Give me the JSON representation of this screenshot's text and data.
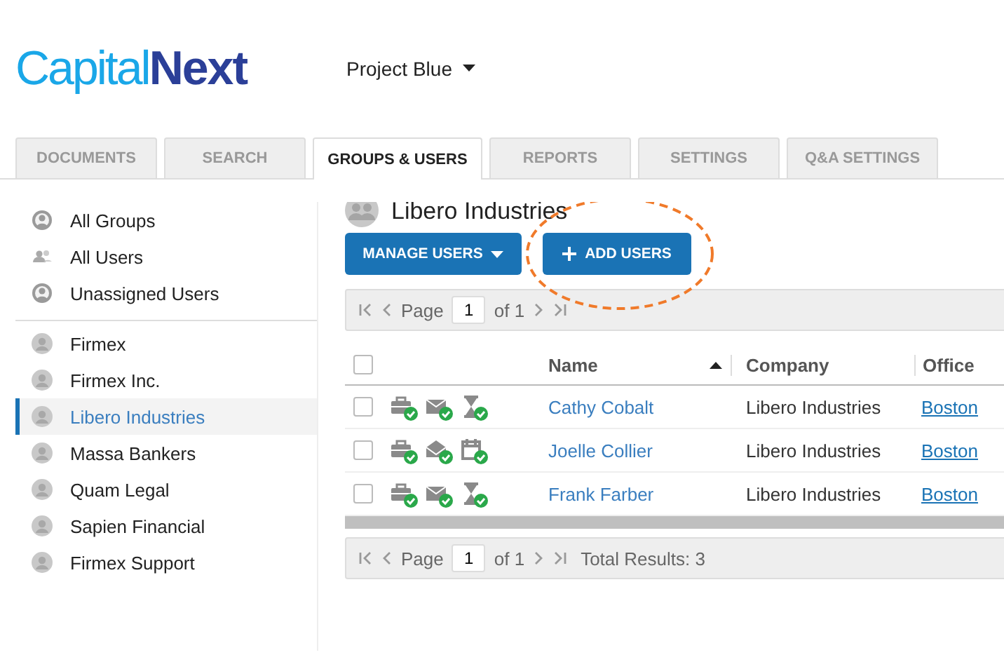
{
  "logo": {
    "part_1": "Capital",
    "part_2": "Next"
  },
  "project": {
    "label": "Project Blue"
  },
  "tabs": [
    {
      "label": "DOCUMENTS",
      "selected": false
    },
    {
      "label": "SEARCH",
      "selected": false
    },
    {
      "label": "GROUPS & USERS",
      "selected": true
    },
    {
      "label": "REPORTS",
      "selected": false
    },
    {
      "label": "SETTINGS",
      "selected": false
    },
    {
      "label": "Q&A SETTINGS",
      "selected": false
    }
  ],
  "sidebar": {
    "sections": [
      {
        "items": [
          {
            "label": "All Groups",
            "kind": "ring",
            "selected": false
          },
          {
            "label": "All Users",
            "kind": "people",
            "selected": false
          },
          {
            "label": "Unassigned Users",
            "kind": "ring",
            "selected": false
          }
        ]
      },
      {
        "items": [
          {
            "label": "Firmex",
            "kind": "group",
            "selected": false
          },
          {
            "label": "Firmex Inc.",
            "kind": "group",
            "selected": false
          },
          {
            "label": "Libero Industries",
            "kind": "group",
            "selected": true
          },
          {
            "label": "Massa Bankers",
            "kind": "group",
            "selected": false
          },
          {
            "label": "Quam Legal",
            "kind": "group",
            "selected": false
          },
          {
            "label": "Sapien Financial",
            "kind": "group",
            "selected": false
          },
          {
            "label": "Firmex Support",
            "kind": "group",
            "selected": false
          }
        ]
      }
    ]
  },
  "group": {
    "title": "Libero Industries"
  },
  "buttons": [
    {
      "label": "MANAGE USERS",
      "kind": "dropdown"
    },
    {
      "label": "ADD USERS",
      "kind": "add",
      "highlighted": true
    }
  ],
  "top_pager": {
    "page_label": "Page",
    "page": "1",
    "of": "of 1"
  },
  "table": {
    "select_all": {
      "checked": false
    },
    "columns": [
      {
        "label": "Name",
        "sorted": true
      },
      {
        "label": "Company",
        "sorted": false
      },
      {
        "label": "Office",
        "sorted": false
      }
    ],
    "rows": [
      {
        "checked": false,
        "icons": [
          {
            "kind": "briefcase"
          },
          {
            "kind": "envelope"
          },
          {
            "kind": "hourglass"
          }
        ],
        "name": "Cathy Cobalt",
        "company": "Libero Industries",
        "office": "Boston"
      },
      {
        "checked": false,
        "icons": [
          {
            "kind": "briefcase"
          },
          {
            "kind": "envelope-open"
          },
          {
            "kind": "calendar"
          }
        ],
        "name": "Joelle Collier",
        "company": "Libero Industries",
        "office": "Boston"
      },
      {
        "checked": false,
        "icons": [
          {
            "kind": "briefcase"
          },
          {
            "kind": "envelope"
          },
          {
            "kind": "hourglass"
          }
        ],
        "name": "Frank Farber",
        "company": "Libero Industries",
        "office": "Boston"
      }
    ]
  },
  "bottom_pager": {
    "page_label": "Page",
    "page": "1",
    "of": "of 1",
    "total": "Total Results: 3"
  }
}
